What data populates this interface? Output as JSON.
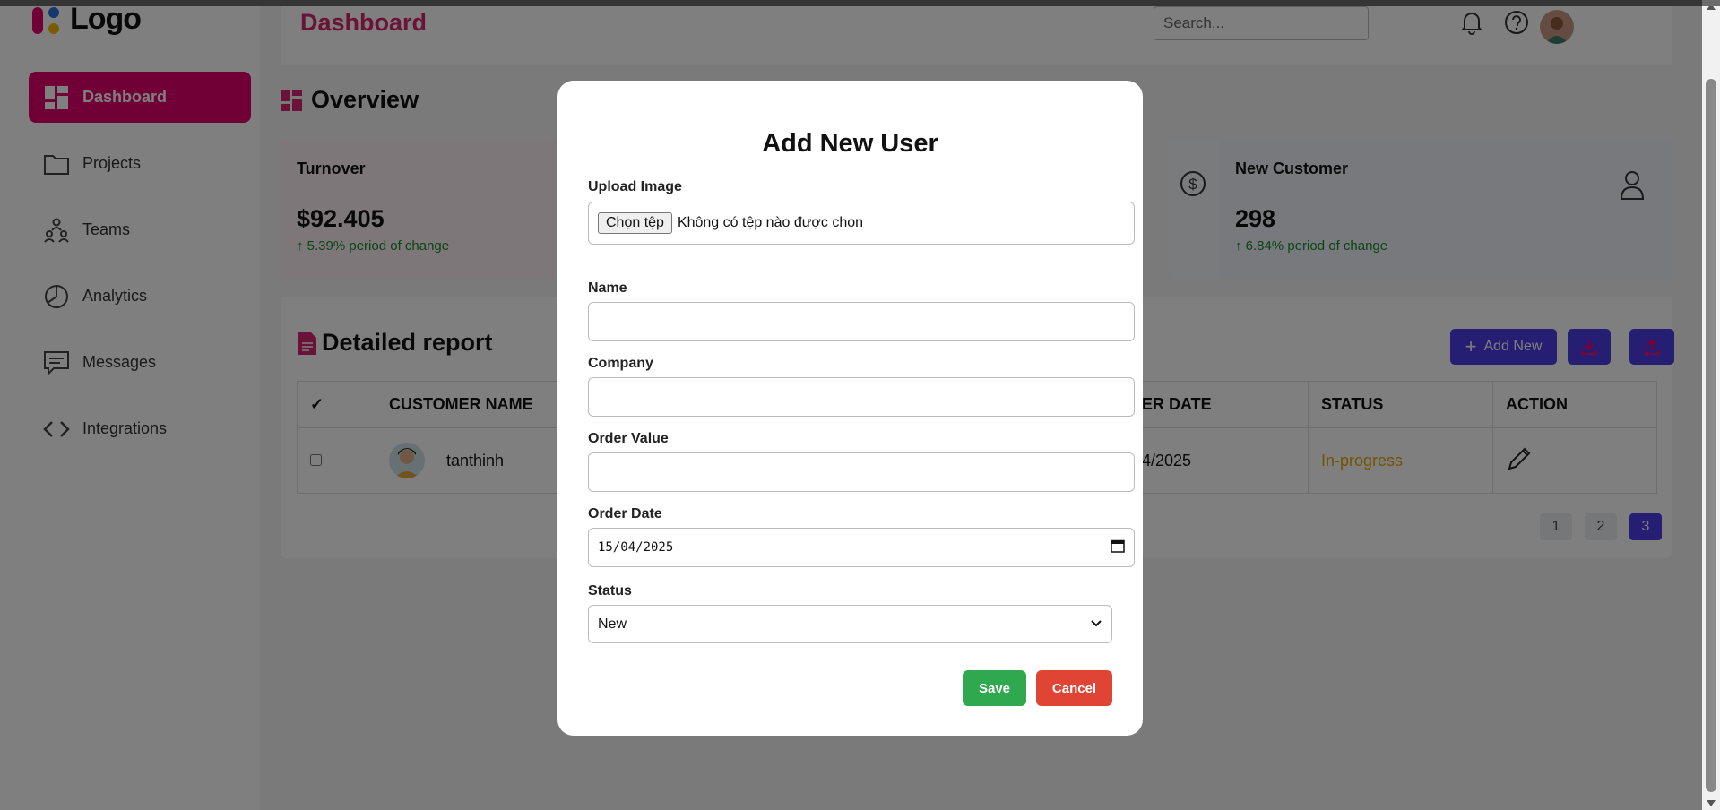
{
  "app": {
    "logo_text": "Logo",
    "page_title": "Dashboard",
    "search_placeholder": "Search..."
  },
  "sidebar": {
    "items": [
      {
        "label": "Dashboard",
        "icon": "dashboard-icon",
        "active": true
      },
      {
        "label": "Projects",
        "icon": "folder-icon"
      },
      {
        "label": "Teams",
        "icon": "teams-icon"
      },
      {
        "label": "Analytics",
        "icon": "pie-chart-icon"
      },
      {
        "label": "Messages",
        "icon": "message-icon"
      },
      {
        "label": "Integrations",
        "icon": "code-icon"
      }
    ]
  },
  "overview": {
    "title": "Overview",
    "cards": [
      {
        "label": "Turnover",
        "value": "$92.405",
        "change": "↑ 5.39% period of change"
      },
      {
        "label": "New Customer",
        "value": "298",
        "change": "↑ 6.84% period of change"
      }
    ]
  },
  "report": {
    "title": "Detailed report",
    "add_new_label": "Add New",
    "columns": [
      "✓",
      "CUSTOMER NAME",
      "ER DATE",
      "STATUS",
      "ACTION"
    ],
    "rows": [
      {
        "name": "tanthinh",
        "date": "4/2025",
        "status": "In-progress"
      }
    ],
    "pages": [
      "1",
      "2",
      "3"
    ],
    "current_page": "3"
  },
  "modal": {
    "title": "Add New User",
    "upload_label": "Upload Image",
    "file_button": "Chọn tệp",
    "file_status": "Không có tệp nào được chọn",
    "name_label": "Name",
    "name_value": "",
    "company_label": "Company",
    "company_value": "",
    "order_value_label": "Order Value",
    "order_value_value": "",
    "order_date_label": "Order Date",
    "order_date_value": "15/04/2025",
    "status_label": "Status",
    "status_value": "New",
    "save_label": "Save",
    "cancel_label": "Cancel"
  },
  "colors": {
    "accent": "#e3006e",
    "primary_button": "#4a3ce6",
    "save": "#2fa84f",
    "cancel": "#e04434",
    "in_progress": "#e0a800",
    "positive_change": "#168a2a"
  }
}
